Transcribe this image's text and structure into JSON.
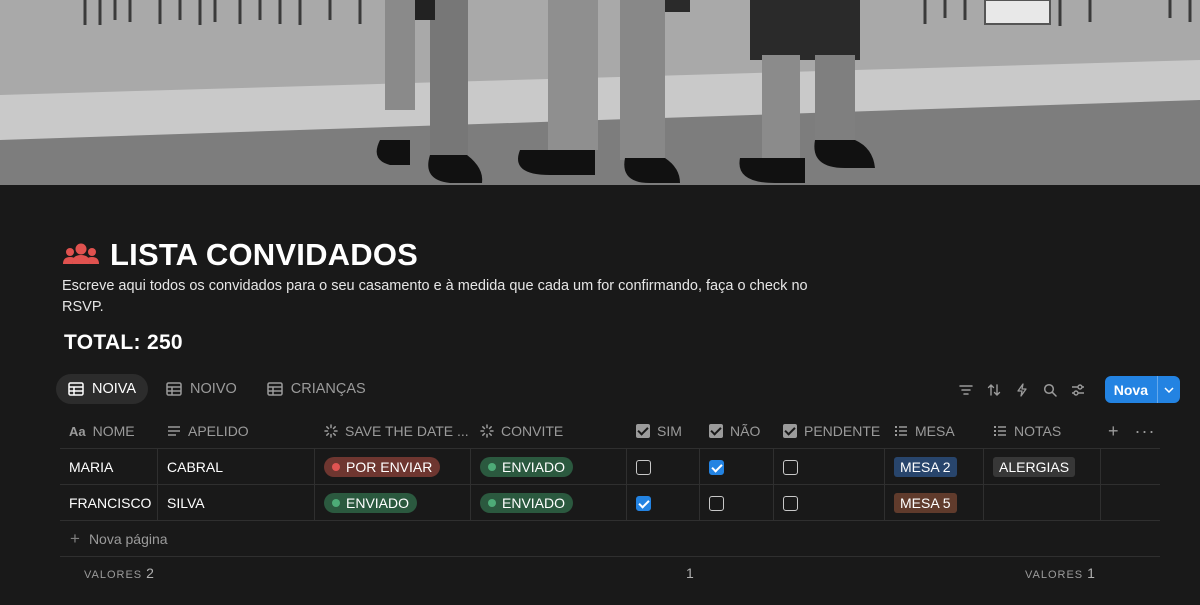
{
  "cover": {
    "description_icon": "cover-photo"
  },
  "page": {
    "icon": "people-icon",
    "title": "LISTA CONVIDADOS",
    "description": "Escreve aqui todos os convidados para o seu casamento e à medida que cada um for confirmando, faça o check no RSVP.",
    "total": "TOTAL: 250"
  },
  "tabs": [
    {
      "label": "NOIVA",
      "active": true
    },
    {
      "label": "NOIVO",
      "active": false
    },
    {
      "label": "CRIANÇAS",
      "active": false
    }
  ],
  "toolbar": {
    "icons": [
      "filter-icon",
      "sort-icon",
      "automation-icon",
      "search-icon",
      "settings-icon"
    ],
    "new_label": "Nova"
  },
  "columns": [
    {
      "label": "NOME",
      "icon": "title-icon"
    },
    {
      "label": "APELIDO",
      "icon": "text-icon"
    },
    {
      "label": "SAVE THE DATE ...",
      "icon": "status-icon"
    },
    {
      "label": "CONVITE",
      "icon": "status-icon"
    },
    {
      "label": "SIM",
      "icon": "checkbox-icon"
    },
    {
      "label": "NÃO",
      "icon": "checkbox-icon"
    },
    {
      "label": "PENDENTE",
      "icon": "checkbox-icon"
    },
    {
      "label": "MESA",
      "icon": "list-icon"
    },
    {
      "label": "NOTAS",
      "icon": "list-icon"
    }
  ],
  "rows": [
    {
      "nome": "MARIA",
      "apelido": "CABRAL",
      "save_the_date": "POR ENVIAR",
      "convite": "ENVIADO",
      "sim": false,
      "nao": true,
      "pendente": false,
      "mesa": "MESA 2",
      "notas": "ALERGIAS"
    },
    {
      "nome": "FRANCISCO",
      "apelido": "SILVA",
      "save_the_date": "ENVIADO",
      "convite": "ENVIADO",
      "sim": true,
      "nao": false,
      "pendente": false,
      "mesa": "MESA 5",
      "notas": ""
    }
  ],
  "new_page_label": "Nova página",
  "footer": {
    "left_label": "VALORES",
    "left_value": "2",
    "middle_value": "1",
    "right_label": "VALORES",
    "right_value": "1"
  },
  "colors": {
    "accent": "#2383e2",
    "status_red": "#df5452",
    "status_green": "#4dab77",
    "tag_blue": "#28456c",
    "tag_brown": "#603b2c"
  }
}
